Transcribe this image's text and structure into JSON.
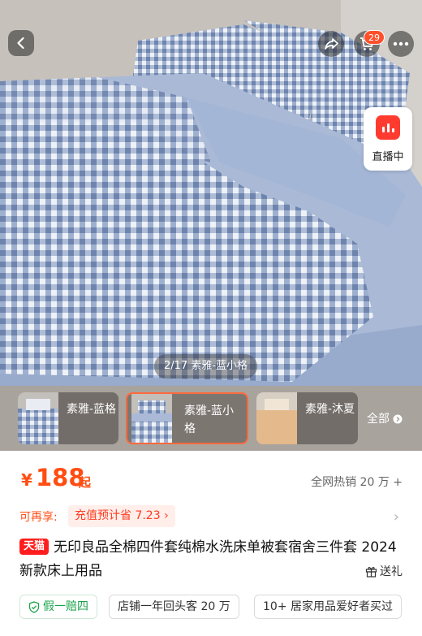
{
  "header": {
    "back_icon": "chevron-left-icon",
    "share_icon": "share-arrow-icon",
    "cart_icon": "cart-icon",
    "cart_count": "29",
    "more_icon": "more-dots-icon"
  },
  "live": {
    "label": "直播中",
    "icon": "live-bars-icon"
  },
  "gallery": {
    "caption": "2/17 素雅-蓝小格"
  },
  "variants": [
    {
      "label": "素雅-蓝格",
      "selected": false
    },
    {
      "label": "素雅-蓝小格",
      "selected": true
    },
    {
      "label": "素雅-沐夏",
      "selected": false
    }
  ],
  "see_all": "全部",
  "price": {
    "currency": "¥",
    "amount": "188",
    "suffix": "起",
    "sales": "全网热销 20 万 +"
  },
  "promo": {
    "label": "可再享:",
    "tag": "充值预计省 7.23"
  },
  "product": {
    "badge": "天猫",
    "title": "无印良品全棉四件套纯棉水洗床单被套宿舍三件套 2024 新款床上用品",
    "gift": "送礼"
  },
  "chips": [
    {
      "label": "假一赔四",
      "icon": "shield-check-icon"
    },
    {
      "label": "店铺一年回头客 20 万"
    },
    {
      "label": "10+ 居家用品爱好者买过"
    }
  ],
  "colors": {
    "accent": "#ff4e13",
    "tmall_red": "#ff1d1d",
    "gingham_blue": "#8c9fc4"
  }
}
